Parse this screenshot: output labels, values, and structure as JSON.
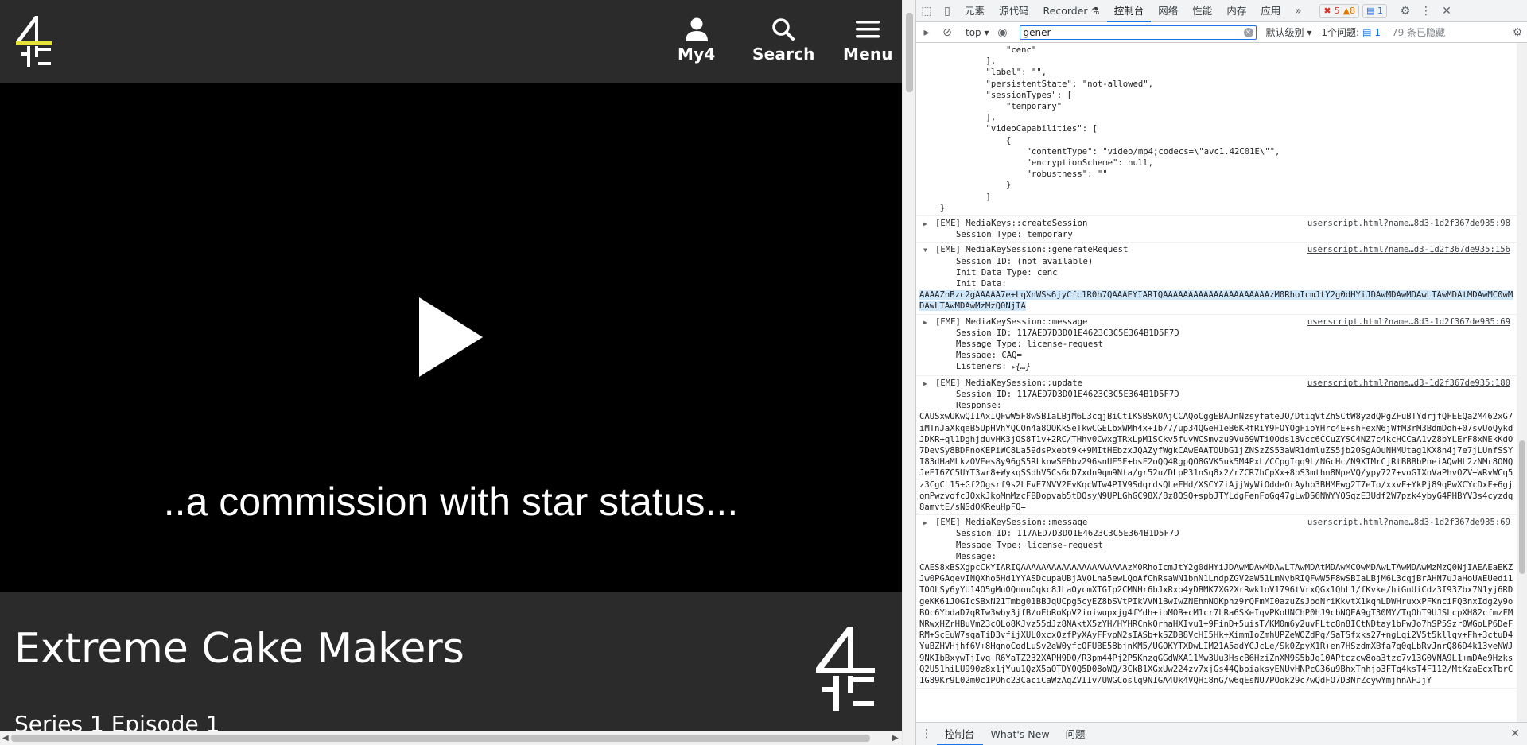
{
  "site": {
    "header": {
      "my4_label": "My4",
      "search_label": "Search",
      "menu_label": "Menu"
    },
    "player": {
      "subtitle": "..a commission with star status..."
    },
    "info": {
      "title": "Extreme Cake Makers",
      "episode": "Series 1 Episode 1"
    }
  },
  "devtools": {
    "tabs": [
      "元素",
      "源代码",
      "Recorder",
      "控制台",
      "网络",
      "性能",
      "内存",
      "应用"
    ],
    "active_tab": "控制台",
    "badges": {
      "errors": "5",
      "warnings": "8",
      "info": "1"
    },
    "toolbar": {
      "context": "top",
      "filter_value": "gener",
      "level": "默认级别",
      "issues_label": "1个问题:",
      "issues_count": "1",
      "hidden": "79 条已隐藏"
    },
    "console": {
      "config_tail": [
        "        \"cenc\"",
        "    ],",
        "    \"label\": \"\",",
        "    \"persistentState\": \"not-allowed\",",
        "    \"sessionTypes\": [",
        "        \"temporary\"",
        "    ],",
        "    \"videoCapabilities\": [",
        "        {",
        "            \"contentType\": \"video/mp4;codecs=\\\"avc1.42C01E\\\"\",",
        "            \"encryptionScheme\": null,",
        "            \"robustness\": \"\"",
        "        }",
        "    ]",
        "}"
      ],
      "m1": {
        "head": "[EME] MediaKeys::createSession",
        "src": "userscript.html?name…8d3-1d2f367de935:98",
        "lines": [
          "Session Type: temporary"
        ]
      },
      "m2": {
        "head": "[EME] MediaKeySession::generateRequest",
        "src": "userscript.html?name…d3-1d2f367de935:156",
        "lines": [
          "Session ID: (not available)",
          "Init Data Type: cenc",
          "Init Data:"
        ],
        "init_data": "AAAAZnBzc2gAAAAA7e+LqXnWSs6jyCfc1R0h7QAAAEYIARIQAAAAAAAAAAAAAAAAAAAAAzM0RhoIcmJtY2g0dHYiJDAwMDAwMDAwLTAwMDAtMDAwMC0wMDAwLTAwMDAwMzMzQ0NjIA"
      },
      "m3": {
        "head": "[EME] MediaKeySession::message",
        "src": "userscript.html?name…8d3-1d2f367de935:69",
        "lines": [
          "Session ID: 117AED7D3D01E4623C3C5E364B1D5F7D",
          "Message Type: license-request",
          "Message: CAQ="
        ],
        "listeners_label": "Listeners:",
        "listeners_value": "{…}"
      },
      "m4": {
        "head": "[EME] MediaKeySession::update",
        "src": "userscript.html?name…d3-1d2f367de935:180",
        "lines": [
          "Session ID: 117AED7D3D01E4623C3C5E364B1D5F7D",
          "Response:"
        ],
        "blob": "CAUSxwUKwQIIAxIQFwW5F8wSBIaLBjM6L3cqjBiCtIKSBSKOAjCCAQoCggEBAJnNzsyfateJO/DtiqVtZhSCtW8yzdQPgZFuBTYdrjfQFEEQa2M462xG7iMTnJaXkqeB5UpHVhYQCOn4a8OOKkSeTkwCGELbxWMh4x+Ib/7/up34QGeH1eB6KRfRiY9FOYOgFioYHrc4E+shFexN6jWfM3rM3BdmDoh+07svUoQykdJDKR+ql1DghjduvHK3jOS8T1v+2RC/THhv0CwxgTRxLpM1SCkv5fuvWCSmvzu9Vu69WTi0Ods18Vcc6CCuZYSC4NZ7c4kcHCCaA1vZ8bYLErF8xNEkKdO7DevSy8BDFnoKEPiWC8La59dsPxebt9k+9MItHEbzxJQAZyfWgkCAwEAATOUbG1jZNSzZS53aWR1dmluZS5jb20SgAOuNHMUtag1KX8n4j7e7jLUnfSSYI83dHaMLkzOVEes8y96gS5RLknwSE0bv296snUE5F+bsF2oQQ4RgpQO8GVK5uk5M4PxL/CCpgIqq9L/NGcHc/N9XTMrCjRtBBBbPneiAQwHL2zNMr8ONQJeEI6ZC5UYT3wr8+WykqSSdhV5Cs6cD7xdn9qm9Nta/gr52u/DLpP31nSq8x2/rZCR7hCpXx+8pS3mthn8NpeVQ/ypy727+voGIXnVaPhvOZV+WRvWCq5z3CgCL15+Gf2Ogsrf9s2LFvE7NVV2FvKqcWTw4PIV9SdqrdsQLeFHd/XSCYZiAjjWyWiOddeOrAyhb3BHMEwg2T7eTo/xxvF+YkPj89qPwXCYcDxF+6gjomPwzvofcJOxkJkoMmMzcFBDopvab5tDQsyN9UPLGhGC98X/8z8QSQ+spbJTYLdgFenFoGq47gLwDS6NWYYQSqzE3Udf2W7pzk4ybyG4PHBYV3s4cyzdq8amvtE/sNSdOKReuHpFQ="
      },
      "m5": {
        "head": "[EME] MediaKeySession::message",
        "src": "userscript.html?name…8d3-1d2f367de935:69",
        "lines": [
          "Session ID: 117AED7D3D01E4623C3C5E364B1D5F7D",
          "Message Type: license-request",
          "Message:"
        ],
        "blob": "CAES8xBSXgpcCkYIARIQAAAAAAAAAAAAAAAAAAAAAzM0RhoIcmJtY2g0dHYiJDAwMDAwMDAwLTAwMDAtMDAwMC0wMDAwLTAwMDAwMzMzQ0NjIAEAEaEKZJw0PGAqevINQXho5Hd1YYASDcupaUBjAVOLna5ewLQoAfChRsaWN1bnN1LndpZGV2aW51LmNvbRIQFwW5F8wSBIaLBjM6L3cqjBrAHN7uJaHoUWEUedi1TOOLSy6yYU14O5gMu0QnouOqkc8JLaOycmXTGIp2CMNHr6bJxRxo4yDBMK7XG2XrRwk1oV1796tVrxQGx1QbL1/fKvke/hiGnUiCdz3I93Zbx7N1yj6RDgeKK61JOGIcSBxN21Tmbg01BBJqUCpg5cyEZ8bSVtPIkVVN1BwIwZNEhmNOKphz9rQFmMI0azuZsJpdNriKkvtX1kqnLDWHruxxPFKnciFQ3nxIdg2y9oBOc6YbdaD7qRIw3wby3jfB/oEbRoKpV2ioiwupxjg4fYdh+ioMOB+cM1cr7LRa6SKeIqvPKoUNChP0hJ9cbNQEA9gT30MY/TqOhT9UJSLcpXH82cfmzFMNRwxHZrHBuVm23cOLo8KJvz55dJz8NAktX5zYH/HYHRCnkQrhaHXIvu1+9FinD+5uisT/KM0m6y2uvFLtc8n8ICtNDtay1bFwJo7hSP5Szr0WGoLP6DeFRM+ScEuW7sqaTiD3vfijXUL0xcxQzfPyXAyFFvpN2sIASb+kSZDB8VcHI5Hk+XimmIoZmhUPZeWOZdPq/SaTSfxks27+ngLqi2V5t5kllqv+Fh+3ctuD4YuBZHVHjhf6V+8HgnoCodLuSv2eW0yfcOFUBE58bjnKM5/UGOKYTXDwLIM21A5adYCJcLe/Sk0ZpyX1R+en7HSzdmXBfa7g0qLbRvJnrQ86D4k13yeNWJ9NKIbBxywTjIvq+R6YaTZ232XAPH9D0/R3pm44Pj2P5KnzqGGdWXA11Mw3Uu3HscB6HziZnXM9S5bJg10APtczcw8oa3tzc7v13G0VNA9L1+mDAe9HzksQ2U51hiLU990z8x1jYuu1QzX5aOTDY0Q5D08oWQ/3CkB1XGxUw224zv7xjGs44QboiaksyENUvHNPcG36u9BhxTnhjo3FTq4ksT4F112/MtKzaEcxTbrC1G89Kr9L02m0c1POhc23CaciCaWzAqZVIIv/UWGCoslq9NIGA4Uk4VQHi8nG/w6qEsNU7POok29c7wQdFO7D3NrZcywYmjhnAFJjY"
      }
    },
    "drawer": {
      "tabs": [
        "控制台",
        "What's New",
        "问题"
      ],
      "active": "控制台"
    }
  }
}
